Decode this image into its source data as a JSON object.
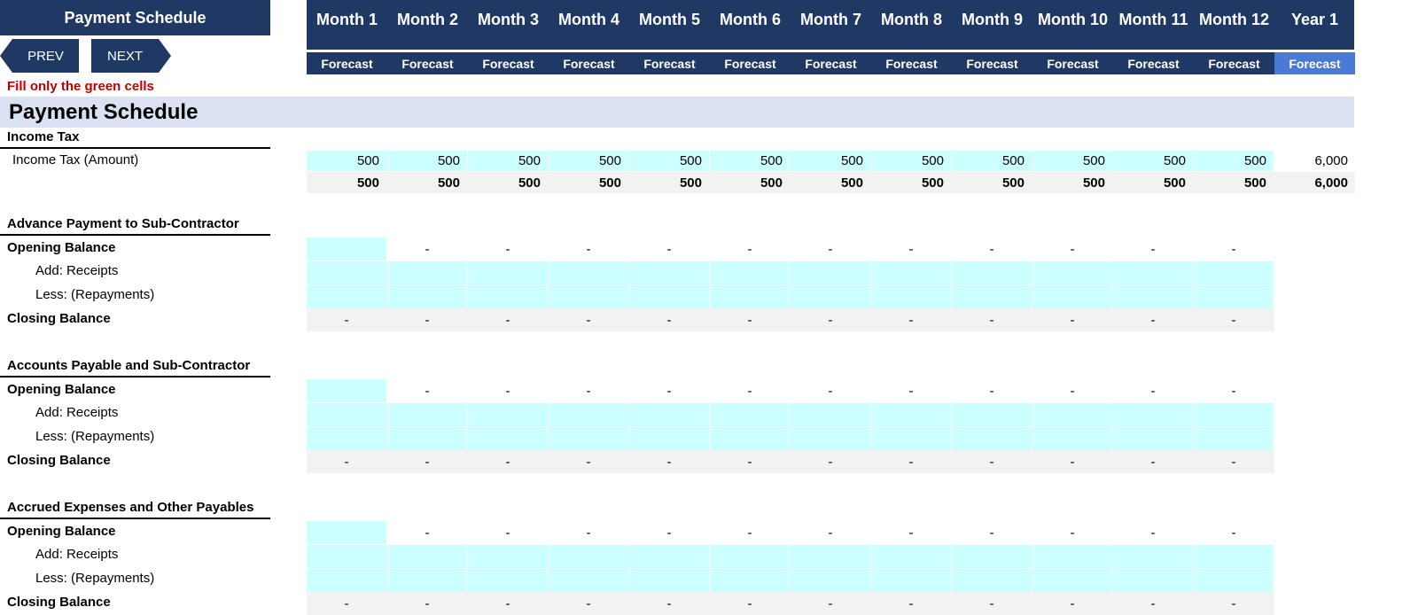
{
  "header": {
    "title": "Payment Schedule",
    "months": [
      "Month 1",
      "Month 2",
      "Month 3",
      "Month 4",
      "Month 5",
      "Month 6",
      "Month 7",
      "Month 8",
      "Month 9",
      "Month 10",
      "Month 11",
      "Month 12"
    ],
    "year_label": "Year 1",
    "forecast_label": "Forecast"
  },
  "nav": {
    "prev_label": "PREV",
    "next_label": "NEXT"
  },
  "note": "Fill only the green cells",
  "section_title": "Payment Schedule",
  "income_tax": {
    "title": "Income Tax",
    "row_label": "Income Tax (Amount)",
    "amounts": [
      "500",
      "500",
      "500",
      "500",
      "500",
      "500",
      "500",
      "500",
      "500",
      "500",
      "500",
      "500"
    ],
    "amount_total": "6,000",
    "totals": [
      "500",
      "500",
      "500",
      "500",
      "500",
      "500",
      "500",
      "500",
      "500",
      "500",
      "500",
      "500"
    ],
    "total_total": "6,000"
  },
  "groups": [
    {
      "title": "Advance Payment to Sub-Contractor",
      "opening_label": "Opening Balance",
      "receipts_label": "Add: Receipts",
      "repayments_label": "Less: (Repayments)",
      "closing_label": "Closing Balance",
      "opening_values": [
        "",
        "-",
        "-",
        "-",
        "-",
        "-",
        "-",
        "-",
        "-",
        "-",
        "-",
        "-"
      ],
      "closing_values": [
        "-",
        "-",
        "-",
        "-",
        "-",
        "-",
        "-",
        "-",
        "-",
        "-",
        "-",
        "-"
      ]
    },
    {
      "title": "Accounts Payable and Sub-Contractor",
      "opening_label": "Opening Balance",
      "receipts_label": "Add: Receipts",
      "repayments_label": "Less: (Repayments)",
      "closing_label": "Closing Balance",
      "opening_values": [
        "",
        "-",
        "-",
        "-",
        "-",
        "-",
        "-",
        "-",
        "-",
        "-",
        "-",
        "-"
      ],
      "closing_values": [
        "-",
        "-",
        "-",
        "-",
        "-",
        "-",
        "-",
        "-",
        "-",
        "-",
        "-",
        "-"
      ]
    },
    {
      "title": "Accrued Expenses and Other Payables",
      "opening_label": "Opening Balance",
      "receipts_label": "Add: Receipts",
      "repayments_label": "Less: (Repayments)",
      "closing_label": "Closing Balance",
      "opening_values": [
        "",
        "-",
        "-",
        "-",
        "-",
        "-",
        "-",
        "-",
        "-",
        "-",
        "-",
        "-"
      ],
      "closing_values": [
        "-",
        "-",
        "-",
        "-",
        "-",
        "-",
        "-",
        "-",
        "-",
        "-",
        "-",
        "-"
      ]
    }
  ]
}
